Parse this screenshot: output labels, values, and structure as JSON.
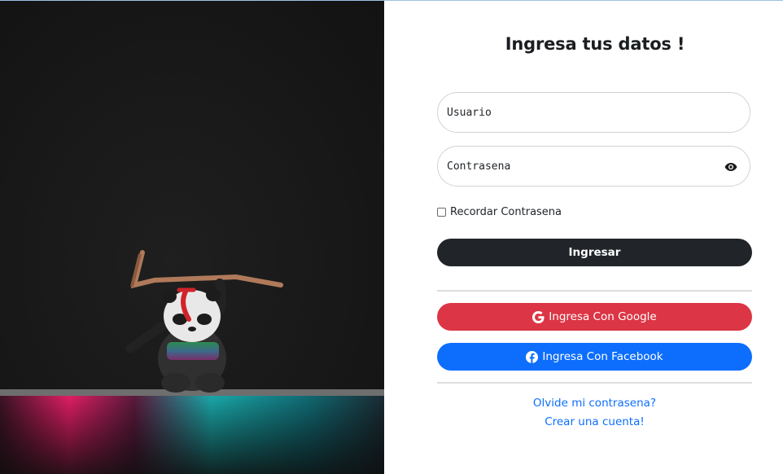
{
  "login": {
    "title": "Ingresa tus datos !",
    "username_placeholder": "Usuario",
    "password_placeholder": "Contrasena",
    "remember_label": "Recordar Contrasena",
    "submit_label": "Ingresar",
    "google_label": "Ingresa Con Google",
    "facebook_label": "Ingresa Con Facebook",
    "forgot_link": "Olvide mi contrasena?",
    "register_link": "Crear una cuenta!"
  },
  "icons": {
    "eye": "eye-icon",
    "google": "google-icon",
    "facebook": "facebook-icon"
  },
  "colors": {
    "submit": "#212529",
    "google": "#dc3545",
    "facebook": "#0d6efd",
    "link": "#0d6efd"
  }
}
